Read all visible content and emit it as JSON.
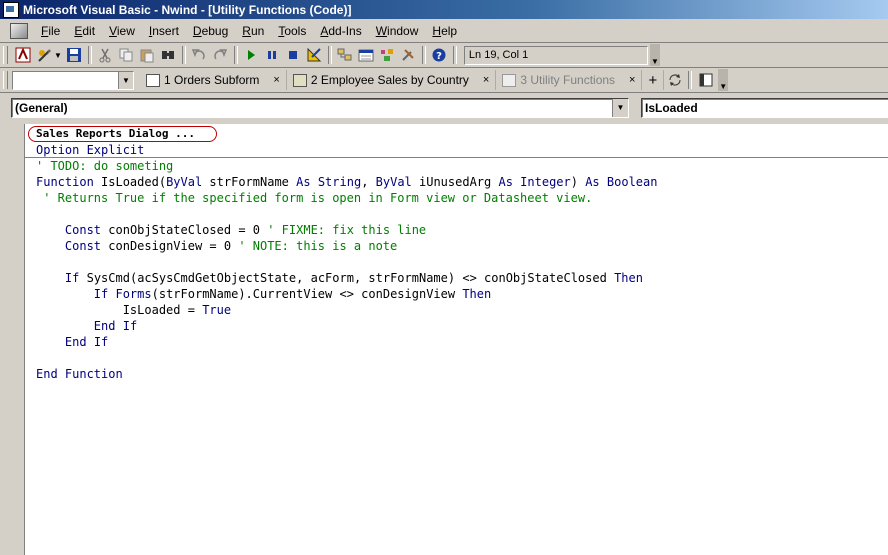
{
  "window": {
    "title": "Microsoft Visual Basic - Nwind - [Utility Functions (Code)]"
  },
  "menu": [
    {
      "label": "File",
      "accel": "F"
    },
    {
      "label": "Edit",
      "accel": "E"
    },
    {
      "label": "View",
      "accel": "V"
    },
    {
      "label": "Insert",
      "accel": "I"
    },
    {
      "label": "Debug",
      "accel": "D"
    },
    {
      "label": "Run",
      "accel": "R"
    },
    {
      "label": "Tools",
      "accel": "T"
    },
    {
      "label": "Add-Ins",
      "accel": "A"
    },
    {
      "label": "Window",
      "accel": "W"
    },
    {
      "label": "Help",
      "accel": "H"
    }
  ],
  "toolbar": {
    "position_text": "Ln 19, Col 1",
    "icons": [
      "view-access-icon",
      "insert-module-icon",
      "save-icon",
      "cut-icon",
      "copy-icon",
      "paste-icon",
      "find-icon",
      "undo-icon",
      "redo-icon",
      "run-icon",
      "break-icon",
      "reset-icon",
      "design-mode-icon",
      "project-explorer-icon",
      "properties-icon",
      "object-browser-icon",
      "toolbox-icon",
      "help-icon"
    ]
  },
  "doc_tabs": {
    "combo_value": "",
    "tabs": [
      {
        "label": "1 Orders Subform",
        "active": true
      },
      {
        "label": "2 Employee Sales by Country",
        "active": true
      },
      {
        "label": "3 Utility Functions",
        "active": false
      }
    ],
    "add_label": "+",
    "close_glyph": "×"
  },
  "procedure_bar": {
    "object": "(General)",
    "procedure": "IsLoaded"
  },
  "code": {
    "proc_header": "Sales Reports Dialog ...",
    "lines": [
      "Option Explicit",
      "' TODO: do someting",
      "Function IsLoaded(ByVal strFormName As String, ByVal iUnusedArg As Integer) As Boolean",
      " ' Returns True if the specified form is open in Form view or Datasheet view.",
      "",
      "    Const conObjStateClosed = 0 ' FIXME: fix this line",
      "    Const conDesignView = 0 ' NOTE: this is a note",
      "",
      "    If SysCmd(acSysCmdGetObjectState, acForm, strFormName) <> conObjStateClosed Then",
      "        If Forms(strFormName).CurrentView <> conDesignView Then",
      "            IsLoaded = True",
      "        End If",
      "    End If",
      "",
      "End Function"
    ]
  },
  "colors": {
    "keyword": "#00007f",
    "comment": "#007f00",
    "highlight_circle": "#c00000"
  }
}
